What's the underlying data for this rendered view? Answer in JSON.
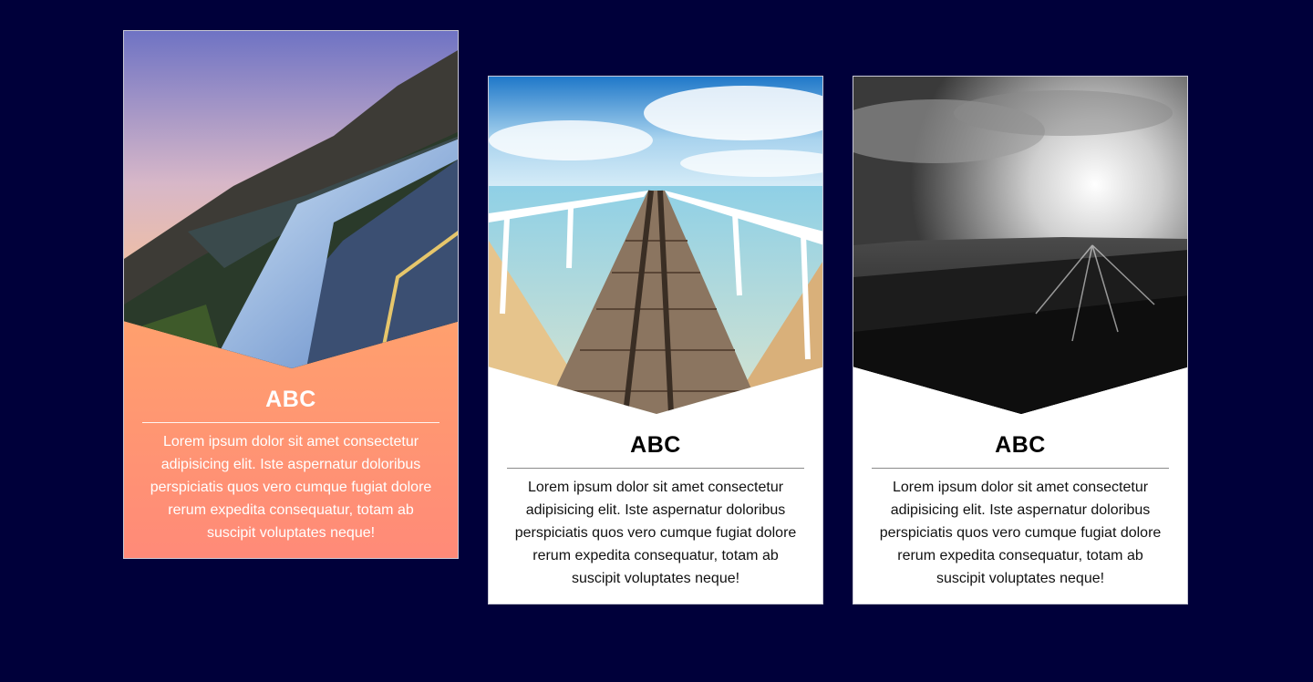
{
  "page": {
    "background": "#00003a"
  },
  "cards": [
    {
      "title": "ABC",
      "description": "Lorem ipsum dolor sit amet consectetur adipisicing elit. Iste aspernatur doloribus perspiciatis quos vero cumque fugiat dolore rerum expedita consequatur, totam ab suscipit voluptates neque!",
      "photo": "coastal-road-sunset",
      "accent": "#ffb25f"
    },
    {
      "title": "ABC",
      "description": "Lorem ipsum dolor sit amet consectetur adipisicing elit. Iste aspernatur doloribus perspiciatis quos vero cumque fugiat dolore rerum expedita consequatur, totam ab suscipit voluptates neque!",
      "photo": "wooden-pier-ocean",
      "accent": "#ffffff"
    },
    {
      "title": "ABC",
      "description": "Lorem ipsum dolor sit amet consectetur adipisicing elit. Iste aspernatur doloribus perspiciatis quos vero cumque fugiat dolore rerum expedita consequatur, totam ab suscipit voluptates neque!",
      "photo": "black-white-sunburst-field",
      "accent": "#ffffff"
    }
  ]
}
